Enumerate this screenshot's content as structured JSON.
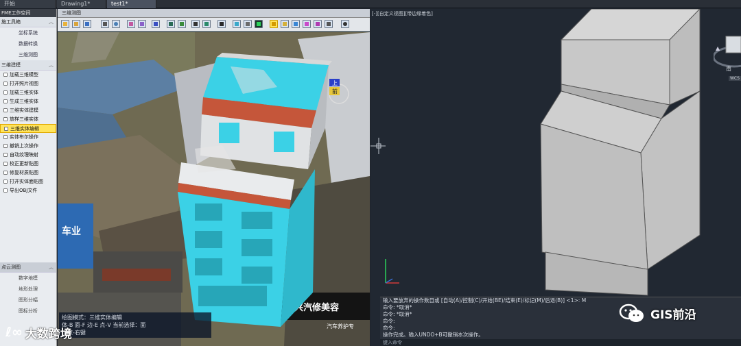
{
  "tabs": [
    {
      "label": "开始"
    },
    {
      "label": "Drawing1*"
    },
    {
      "label": "test1*"
    }
  ],
  "left_panel": {
    "header": "FME工作空间",
    "group1": {
      "label": "施工具箱"
    },
    "sub_items": [
      "坐标系统",
      "数据转换",
      "三维测图"
    ],
    "group2": {
      "label": "三维建模"
    },
    "items": [
      "加载三维模型",
      "打开照片视图",
      "加载三维实体",
      "生成三维实体",
      "三维实体建模",
      "放样三维实体",
      "三维实体编辑",
      "实体布尔操作",
      "撤销上次操作",
      "自动纹理映射",
      "校正更新贴图",
      "修复材质贴图",
      "打开实体面贴图",
      "导出OBJ文件"
    ],
    "selected_index": 6,
    "lower_group": {
      "label": "点云测图"
    },
    "lower_items": [
      "数字地模",
      "地形处理",
      "图形分幅",
      "图标分析"
    ]
  },
  "viewer": {
    "title": "三维测图",
    "status_lines": [
      "绘图模式：三维实体编辑",
      "体-B 面-F 边-E 点-V 当前选择：面",
      "选取-右键"
    ],
    "scene_texts": {
      "shop_sign1": "车业",
      "shop_sign2": "诚兴汽修美容",
      "shop_sign3": "汽车养护专",
      "compass_top": "上",
      "compass_front": "前"
    }
  },
  "cad": {
    "viewport_label": "[-][自定义视图][带边缘着色]",
    "viewcube_label": "南",
    "wcs_label": "WCS",
    "command_lines": [
      "输入要放弃的操作数目或 [自动(A)/控制(C)/开始(BE)/结束(E)/标记(M)/后退(B)] <1>: M",
      "命令: *取消*",
      "命令: *取消*",
      "命令:",
      "命令:",
      "操作完成。输入UNDO+B可撤销本次操作。"
    ],
    "command_input_placeholder": "键入命令"
  },
  "watermarks": {
    "left_logo": "ℓ∞",
    "left_text": "大数跨境",
    "right_text": "GIS前沿"
  },
  "colors": {
    "cyan_model": "#3bd1e6",
    "selection_yellow": "#ffe45c",
    "cad_background": "#212832"
  }
}
